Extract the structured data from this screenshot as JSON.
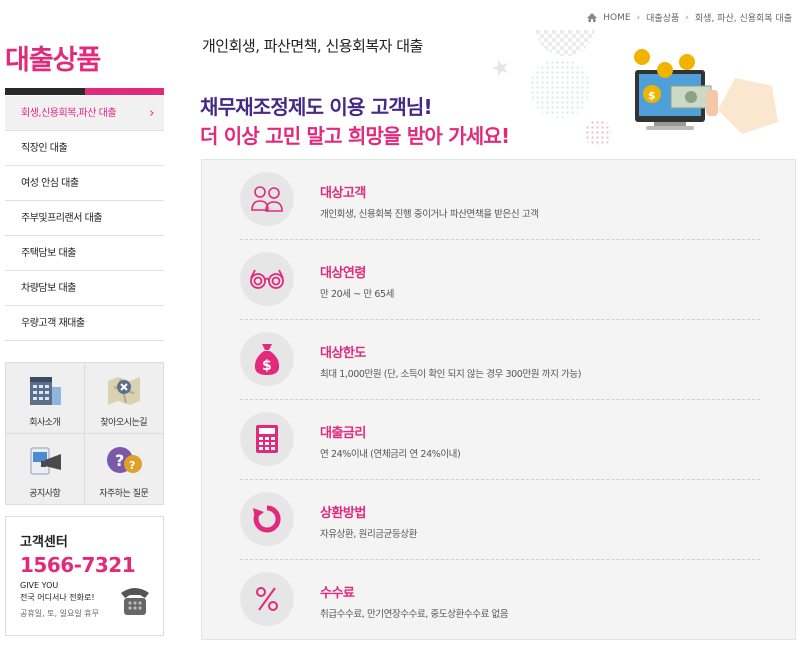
{
  "breadcrumb": [
    "HOME",
    "대출상품",
    "회생, 파산, 신용회복 대출"
  ],
  "sidebar": {
    "title": "대출상품",
    "items": [
      {
        "label": "회생,신용회복,파산 대출",
        "active": true
      },
      {
        "label": "직장인 대출"
      },
      {
        "label": "여성 안심 대출"
      },
      {
        "label": "주부및프리랜서 대출"
      },
      {
        "label": "주택담보 대출"
      },
      {
        "label": "차량담보 대출"
      },
      {
        "label": "우량고객 재대출"
      }
    ],
    "quick_links": [
      {
        "label": "회사소개",
        "icon": "company-icon"
      },
      {
        "label": "찾아오시는길",
        "icon": "map-icon"
      },
      {
        "label": "공지사항",
        "icon": "notice-icon"
      },
      {
        "label": "자주하는 질문",
        "icon": "faq-icon"
      }
    ],
    "customer_center": {
      "title": "고객센터",
      "phone": "1566-7321",
      "line1": "GIVE YOU",
      "line2": "전국 어디서나 전화로!",
      "line3": "공휴일, 토, 일요일 휴무"
    }
  },
  "main": {
    "page_title": "개인회생, 파산면책, 신용회복자 대출",
    "hero_line1": "채무재조정제도 이용 고객님!",
    "hero_line2": "더 이상 고민 말고 희망을 받아 가세요!",
    "items": [
      {
        "title": "대상고객",
        "desc": "개인회생, 신용회복 진행 중이거나 파산면책을 받은신 고객",
        "icon": "people-icon"
      },
      {
        "title": "대상연령",
        "desc": "만 20세 ~ 만 65세",
        "icon": "glasses-icon"
      },
      {
        "title": "대상한도",
        "desc": "최대 1,000만원 (단, 소득이 확인 되지 않는 경우 300만원 까지 가능)",
        "icon": "money-bag-icon"
      },
      {
        "title": "대출금리",
        "desc": "연 24%이내 (연체금리 연 24%이내)",
        "icon": "calculator-icon"
      },
      {
        "title": "상환방법",
        "desc": "자유상환, 원리금균등상환",
        "icon": "refresh-icon"
      },
      {
        "title": "수수료",
        "desc": "취급수수료, 만기연장수수료, 중도상환수수료 없음",
        "icon": "percent-icon"
      }
    ]
  },
  "colors": {
    "accent": "#e2297c",
    "purple": "#442a86",
    "panel": "#f4f4f4"
  }
}
